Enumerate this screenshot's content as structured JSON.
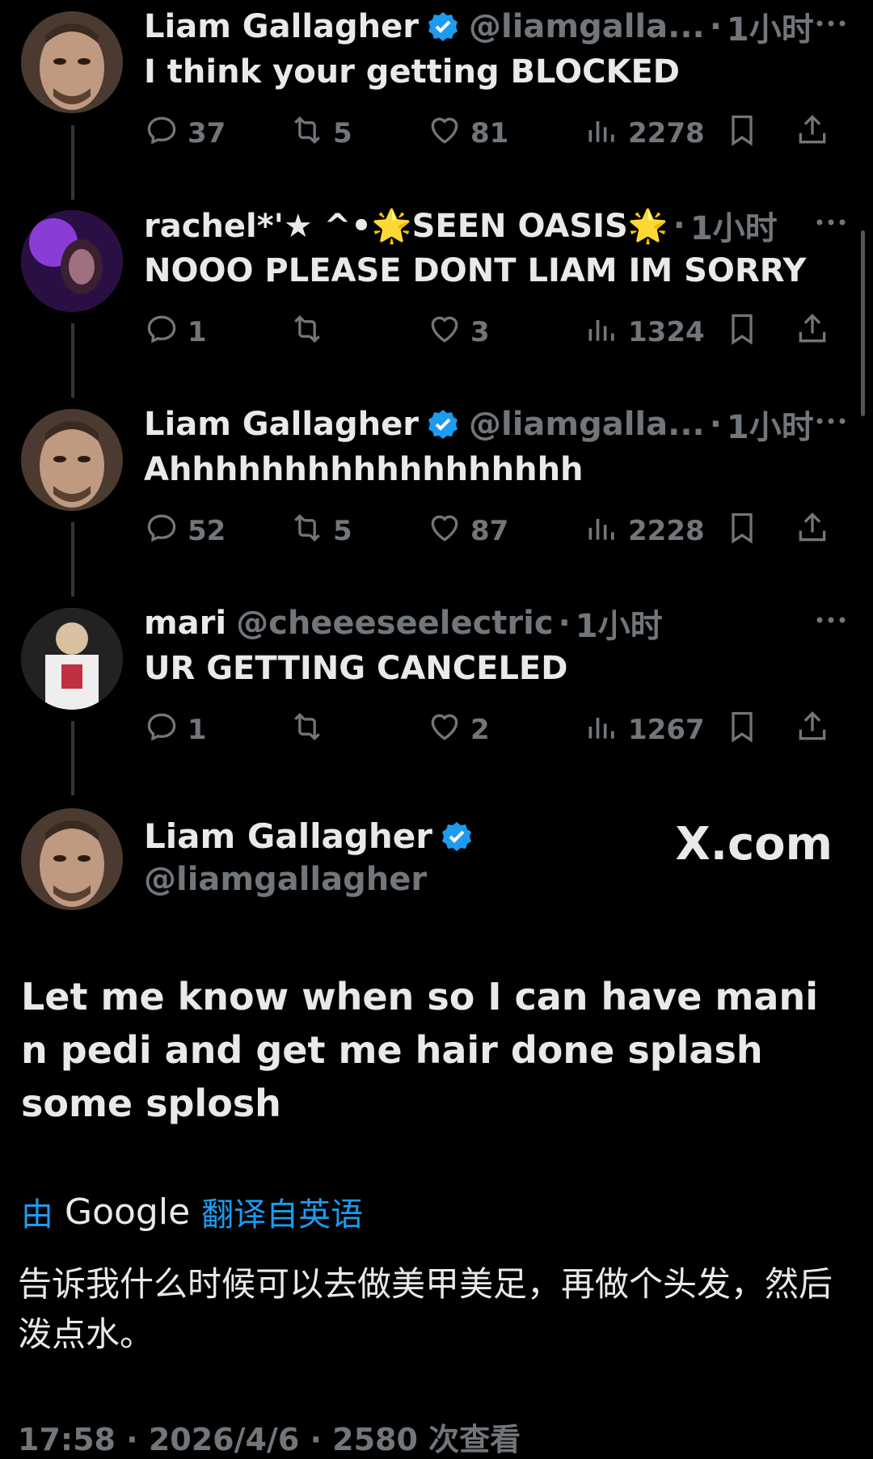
{
  "tweets": [
    {
      "name": "Liam Gallagher",
      "handle": "@liamgalla...",
      "time": "1小时",
      "verified": true,
      "text": "I think your getting BLOCKED",
      "replies": "37",
      "retweets": "5",
      "likes": "81",
      "views": "2278"
    },
    {
      "name": "rachel*'★ ^•🌟SEEN OASIS🌟",
      "handle": "",
      "time": "1小时",
      "verified": false,
      "text": "NOOO PLEASE DONT LIAM IM SORRY",
      "replies": "1",
      "retweets": "",
      "likes": "3",
      "views": "1324"
    },
    {
      "name": "Liam Gallagher",
      "handle": "@liamgalla...",
      "time": "1小时",
      "verified": true,
      "text": "Ahhhhhhhhhhhhhhhhhh",
      "replies": "52",
      "retweets": "5",
      "likes": "87",
      "views": "2228"
    },
    {
      "name": "mari",
      "handle": "@cheeeseelectric",
      "time": "1小时",
      "verified": false,
      "text": "UR GETTING CANCELED",
      "replies": "1",
      "retweets": "",
      "likes": "2",
      "views": "1267"
    }
  ],
  "main": {
    "name": "Liam Gallagher",
    "handle": "@liamgallagher",
    "site": "X.com",
    "text": "Let me know when so I can have mani n pedi and get me hair done splash some splosh",
    "translate_by": "由",
    "translate_google": "Google",
    "translate_link": "翻译自英语",
    "translation": "告诉我什么时候可以去做美甲美足，再做个头发，然后泼点水。",
    "footer": "17:58 · 2026/4/6 · 2580 次查看"
  },
  "colors": {
    "accent": "#1d9bf0",
    "muted": "#71767b",
    "background": "#000000"
  },
  "icons": [
    "reply-icon",
    "retweet-icon",
    "like-icon",
    "views-icon",
    "bookmark-icon",
    "share-icon",
    "verified-icon",
    "more-icon"
  ]
}
